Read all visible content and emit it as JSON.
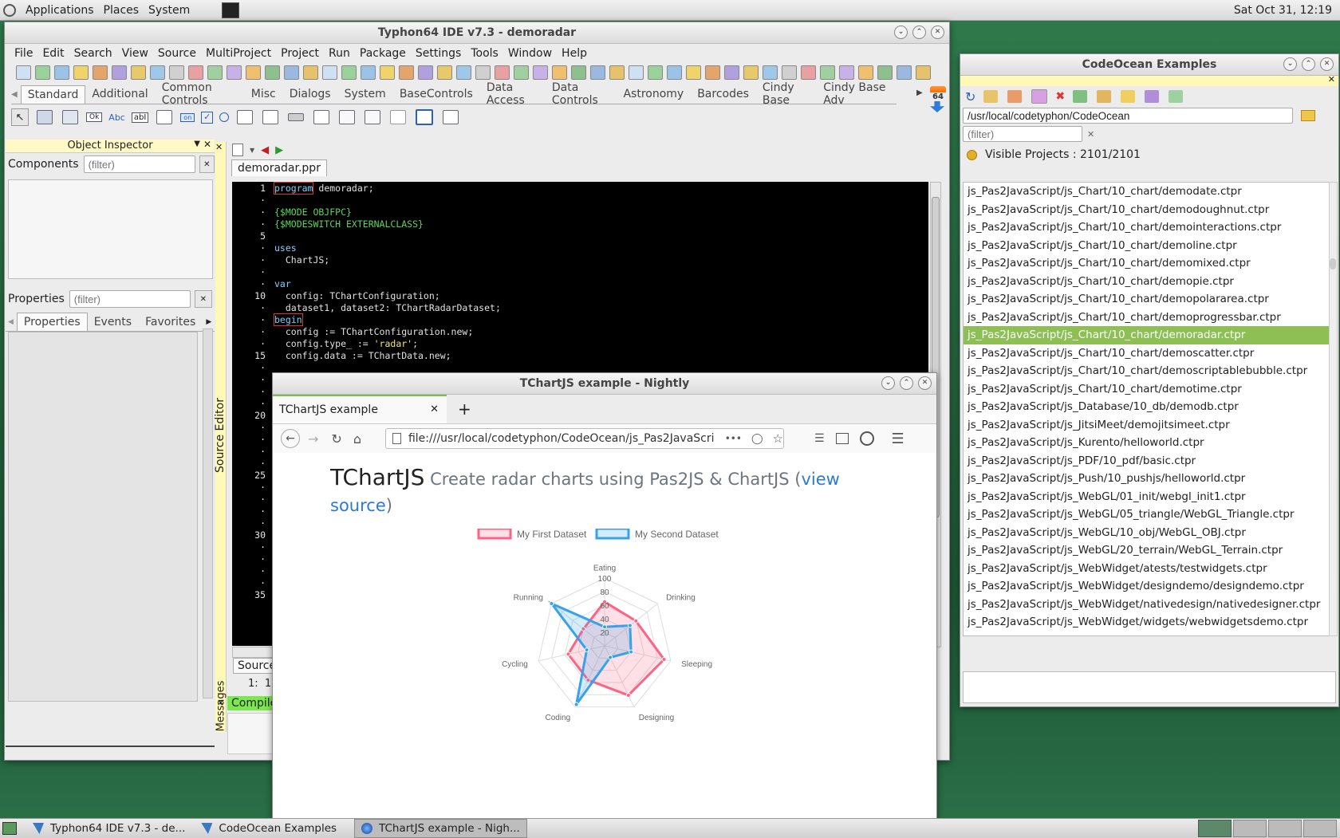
{
  "desktop": {
    "menu": [
      "Applications",
      "Places",
      "System"
    ],
    "clock": "Sat Oct 31, 12:19"
  },
  "taskbar": {
    "tasks": [
      "Typhon64 IDE v7.3 - de...",
      "CodeOcean Examples",
      "TChartJS example - Nigh..."
    ]
  },
  "ide": {
    "title": "Typhon64 IDE v7.3 - demoradar",
    "menu": [
      "File",
      "Edit",
      "Search",
      "View",
      "Source",
      "MultiProject",
      "Project",
      "Run",
      "Package",
      "Settings",
      "Tools",
      "Window",
      "Help"
    ],
    "palette_tabs": [
      "Standard",
      "Additional",
      "Common Controls",
      "Misc",
      "Dialogs",
      "System",
      "BaseControls",
      "Data Access",
      "Data Controls",
      "Astronomy",
      "Barcodes",
      "Cindy Base",
      "Cindy Base Adv"
    ],
    "badge": "64",
    "palette_labels": {
      "ok": "Ok",
      "abc": "Abc",
      "abl": "abI",
      "on": "on"
    },
    "object_inspector": {
      "title": "Object Inspector",
      "components_label": "Components",
      "properties_label": "Properties",
      "filter_placeholder": "(filter)",
      "tabs": [
        "Properties",
        "Events",
        "Favorites"
      ]
    },
    "editor": {
      "side_label": "Source Editor",
      "file_tab": "demoradar.ppr",
      "line_numbers": [
        "1",
        "·",
        "·",
        "·",
        "5",
        "·",
        "·",
        "·",
        "·",
        "10",
        "·",
        "·",
        "·",
        "·",
        "15",
        "·",
        "·",
        "·",
        "·",
        "20",
        "·",
        "·",
        "·",
        "·",
        "25",
        "·",
        "·",
        "·",
        "·",
        "30",
        "·",
        "·",
        "·",
        "·",
        "35"
      ],
      "code": [
        {
          "t": "program",
          "c": "kw",
          "b": "true",
          "r": " demoradar;"
        },
        {
          "t": "",
          "c": "",
          "r": ""
        },
        {
          "t": "{$MODE OBJFPC}",
          "c": "dir",
          "r": ""
        },
        {
          "t": "{$MODESWITCH EXTERNALCLASS}",
          "c": "dir",
          "r": ""
        },
        {
          "t": "",
          "c": "",
          "r": ""
        },
        {
          "t": "uses",
          "c": "kw",
          "r": ""
        },
        {
          "t": "  ChartJS;",
          "c": "",
          "r": ""
        },
        {
          "t": "",
          "c": "",
          "r": ""
        },
        {
          "t": "var",
          "c": "kw",
          "r": ""
        },
        {
          "t": "  config: TChartConfiguration;",
          "c": "",
          "r": ""
        },
        {
          "t": "  dataset1, dataset2: TChartRadarDataset;",
          "c": "",
          "r": ""
        },
        {
          "t": "begin",
          "c": "kw",
          "b": "true",
          "r": ""
        },
        {
          "t": "  config := TChartConfiguration.new;",
          "c": "",
          "r": ""
        },
        {
          "t": "  config.type_ := ",
          "c": "",
          "s": "'radar'",
          "r": ";"
        },
        {
          "t": "  config.data := TChartData.new;",
          "c": "",
          "r": ""
        }
      ],
      "bottom_tab": "Source",
      "position": "1:  1"
    },
    "messages": {
      "label": "Messages",
      "compile_tab": "Compile"
    }
  },
  "codeocean": {
    "title": "CodeOcean Examples",
    "path": "/usr/local/codetyphon/CodeOcean",
    "filter_placeholder": "(filter)",
    "visible_projects": "Visible Projects : 2101/2101",
    "items": [
      "js_Pas2JavaScript/js_Chart/10_chart/demodate.ctpr",
      "js_Pas2JavaScript/js_Chart/10_chart/demodoughnut.ctpr",
      "js_Pas2JavaScript/js_Chart/10_chart/demointeractions.ctpr",
      "js_Pas2JavaScript/js_Chart/10_chart/demoline.ctpr",
      "js_Pas2JavaScript/js_Chart/10_chart/demomixed.ctpr",
      "js_Pas2JavaScript/js_Chart/10_chart/demopie.ctpr",
      "js_Pas2JavaScript/js_Chart/10_chart/demopolararea.ctpr",
      "js_Pas2JavaScript/js_Chart/10_chart/demoprogressbar.ctpr",
      "js_Pas2JavaScript/js_Chart/10_chart/demoradar.ctpr",
      "js_Pas2JavaScript/js_Chart/10_chart/demoscatter.ctpr",
      "js_Pas2JavaScript/js_Chart/10_chart/demoscriptablebubble.ctpr",
      "js_Pas2JavaScript/js_Chart/10_chart/demotime.ctpr",
      "js_Pas2JavaScript/js_Database/10_db/demodb.ctpr",
      "js_Pas2JavaScript/js_JitsiMeet/demojitsimeet.ctpr",
      "js_Pas2JavaScript/js_Kurento/helloworld.ctpr",
      "js_Pas2JavaScript/js_PDF/10_pdf/basic.ctpr",
      "js_Pas2JavaScript/js_Push/10_pushjs/helloworld.ctpr",
      "js_Pas2JavaScript/js_WebGL/01_init/webgl_init1.ctpr",
      "js_Pas2JavaScript/js_WebGL/05_triangle/WebGL_Triangle.ctpr",
      "js_Pas2JavaScript/js_WebGL/10_obj/WebGL_OBJ.ctpr",
      "js_Pas2JavaScript/js_WebGL/20_terrain/WebGL_Terrain.ctpr",
      "js_Pas2JavaScript/js_WebWidget/atests/testwidgets.ctpr",
      "js_Pas2JavaScript/js_WebWidget/designdemo/designdemo.ctpr",
      "js_Pas2JavaScript/js_WebWidget/nativedesign/nativedesigner.ctpr",
      "js_Pas2JavaScript/js_WebWidget/widgets/webwidgetsdemo.ctpr"
    ],
    "selected_index": 8
  },
  "browser": {
    "title": "TChartJS example - Nightly",
    "tab": "TChartJS example",
    "url": "file:///usr/local/codetyphon/CodeOcean/js_Pas2JavaScri",
    "more": "•••",
    "heading": "TChartJS",
    "subheading": "Create radar charts using Pas2JS & ChartJS (",
    "link": "view source",
    "close_paren": ")"
  },
  "chart_data": {
    "type": "radar",
    "categories": [
      "Eating",
      "Drinking",
      "Sleeping",
      "Designing",
      "Coding",
      "Cycling",
      "Running"
    ],
    "r_ticks": [
      20,
      40,
      60,
      80,
      100
    ],
    "rlim": [
      0,
      100
    ],
    "legend_position": "top",
    "series": [
      {
        "name": "My First Dataset",
        "color": "#ff6384",
        "values": [
          65,
          59,
          90,
          81,
          56,
          55,
          40
        ]
      },
      {
        "name": "My Second Dataset",
        "color": "#36a2eb",
        "values": [
          28,
          48,
          40,
          19,
          96,
          27,
          100
        ]
      }
    ]
  },
  "colors": {
    "selection": "#8dbf55",
    "editor_bg": "#000000",
    "keyword": "#7fd0ff",
    "directive": "#5bd75b"
  }
}
